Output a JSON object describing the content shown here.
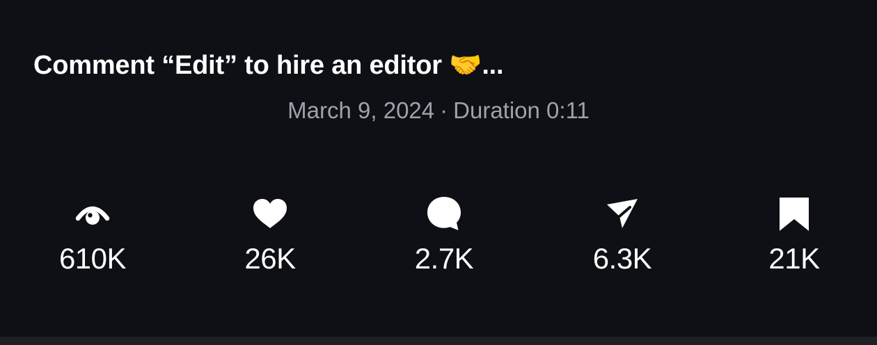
{
  "post": {
    "caption": "Comment “Edit” to hire an editor 🤝...",
    "date": "March 9, 2024",
    "separator": "·",
    "duration": "Duration 0:11"
  },
  "stats": [
    {
      "icon": "eye-icon",
      "value": "610K"
    },
    {
      "icon": "heart-icon",
      "value": "26K"
    },
    {
      "icon": "comment-icon",
      "value": "2.7K"
    },
    {
      "icon": "share-icon",
      "value": "6.3K"
    },
    {
      "icon": "bookmark-icon",
      "value": "21K"
    }
  ],
  "colors": {
    "background": "#0e1015",
    "meta_text": "#9ea2ab",
    "primary_text": "#ffffff",
    "bottom_bar": "#1f2024"
  }
}
